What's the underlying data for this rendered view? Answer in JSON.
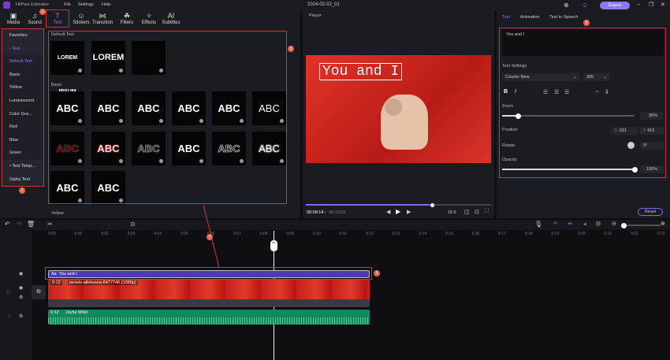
{
  "app": {
    "title": "HitPaw Edimakor",
    "menu": [
      "File",
      "Settings",
      "Help"
    ],
    "project": "2024-02-02_01",
    "export_label": "Export"
  },
  "toolbar": [
    {
      "label": "Media",
      "icon": "media-icon",
      "g": "▣"
    },
    {
      "label": "Sound",
      "icon": "music-icon",
      "g": "♫"
    },
    {
      "label": "Text",
      "icon": "text-icon",
      "g": "T",
      "active": true
    },
    {
      "label": "Stickers",
      "icon": "sticker-icon",
      "g": "☺"
    },
    {
      "label": "Transition",
      "icon": "transition-icon",
      "g": "⋈"
    },
    {
      "label": "Filters",
      "icon": "filter-icon",
      "g": "☘"
    },
    {
      "label": "Effects",
      "icon": "effects-icon",
      "g": "✧"
    },
    {
      "label": "Subtitles",
      "icon": "subtitles-icon",
      "g": "AI"
    }
  ],
  "sidebar": [
    "Favorites",
    "• Text",
    "Default Text",
    "Basic",
    "Yellow",
    "Luminescent",
    "Color Gra...",
    "Red",
    "Blue",
    "Green",
    "• Text Temp...",
    "Giphy Text"
  ],
  "library": {
    "default_title": "Default Text",
    "default": [
      "LOREM IPSUM",
      "LOREM",
      ""
    ],
    "basic_title": "Basic",
    "basic": [
      "ABC",
      "ABC",
      "ABC",
      "ABC",
      "ABC",
      "ABC",
      "ABC",
      "ABC",
      "ABC",
      "ABC",
      "ABC",
      "ABC",
      "ABC",
      "ABC"
    ],
    "yellow_title": "Yellow"
  },
  "badges": [
    "1",
    "2",
    "3",
    "4",
    "5",
    "6"
  ],
  "player": {
    "title": "Player",
    "overlay_text": "You and I",
    "current": "00:08:14",
    "total": "00:12:02",
    "ratio": "16:9",
    "progress": 0.68
  },
  "right": {
    "tabs": [
      "Text",
      "Animation",
      "Text to Speech"
    ],
    "text_value": "You and I",
    "settings_label": "Text Settings",
    "font": "Courier New",
    "size": "300",
    "zoom_label": "Zoom",
    "zoom": "35%",
    "zoom_fraction": 0.12,
    "position_label": "Position",
    "pos_x": "-321",
    "pos_y": "415",
    "pos_x_label": "X",
    "pos_y_label": "Y",
    "rotate_label": "Rotate",
    "rotate": "0°",
    "opacity_label": "Opacity",
    "opacity": "100%",
    "opacity_fraction": 1.0,
    "reset": "Reset"
  },
  "timeline": {
    "ruler": [
      "0:00",
      "0:01",
      "0:02",
      "0:03",
      "0:04",
      "0:05",
      "0:06",
      "0:07",
      "0:08",
      "0:09",
      "0:10",
      "0:11",
      "0:12",
      "0:13",
      "0:14",
      "0:15",
      "0:16",
      "0:17",
      "0:18",
      "0:19",
      "0:20",
      "0:21",
      "0:22",
      "0:23"
    ],
    "text_clip": "You and I",
    "text_clip_icon": "Aa",
    "video_duration": "0:12",
    "video_name": "pexels-alleksana-6477746 (1080p)",
    "audio_duration": "0:12",
    "audio_name": "Joyful Whirl"
  },
  "colors": {
    "accent": "#7b6cf0",
    "text_clip": "#4b3bb0",
    "video_clip": "#c81e1e",
    "audio_clip": "#148a5a",
    "annotation": "#d0323c"
  }
}
